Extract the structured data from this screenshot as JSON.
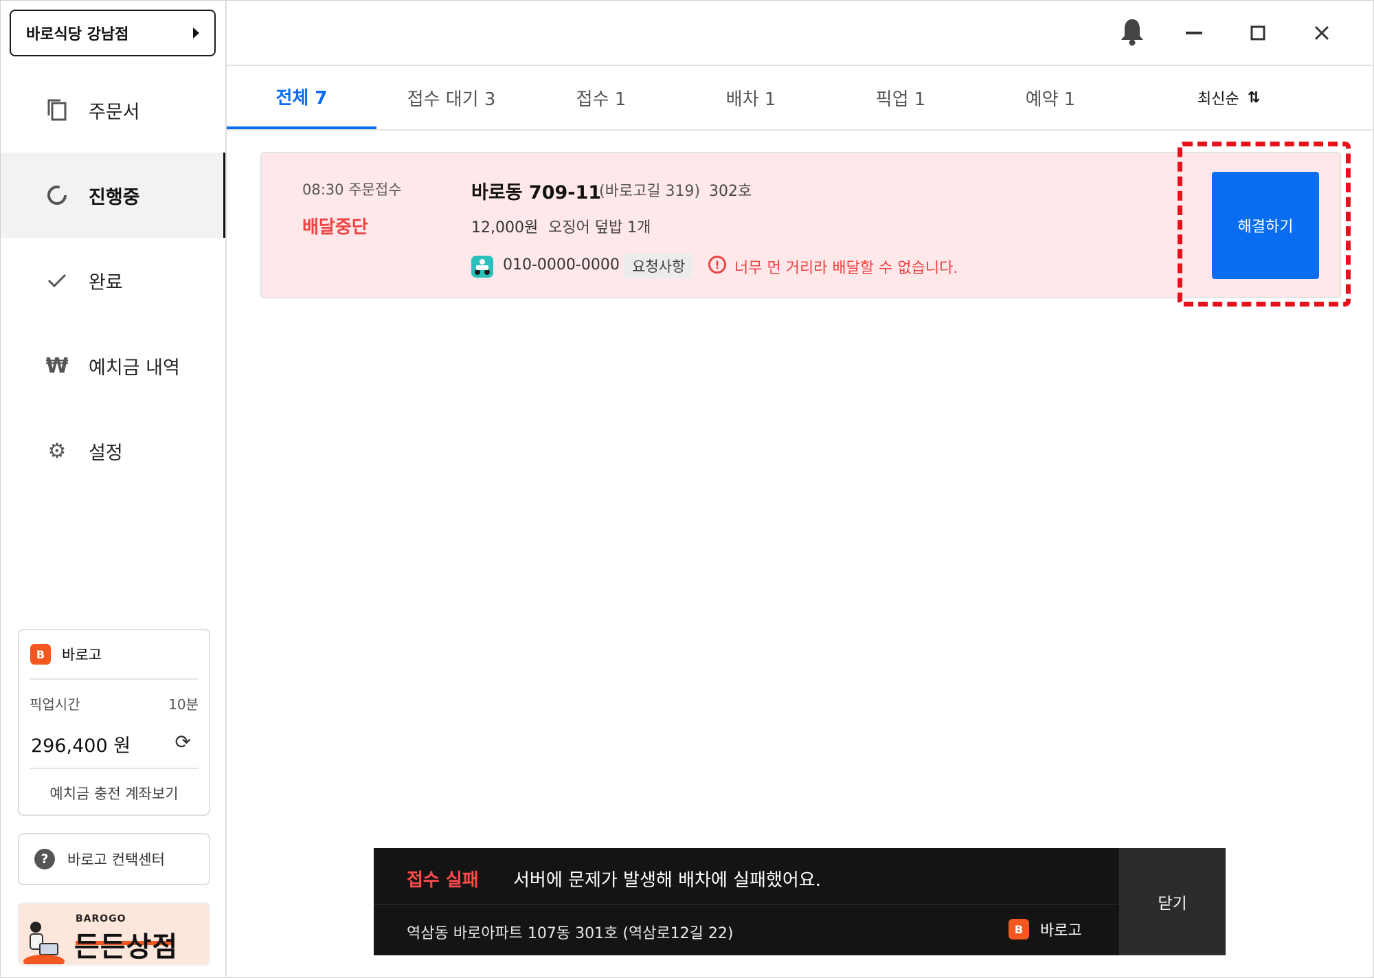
{
  "store": {
    "name": "바로식당 강남점"
  },
  "sidebar": {
    "items": [
      {
        "label": "주문서",
        "icon": "copy-icon"
      },
      {
        "label": "진행중",
        "icon": "progress-icon"
      },
      {
        "label": "완료",
        "icon": "check-icon"
      },
      {
        "label": "예치금 내역",
        "icon": "won-icon"
      },
      {
        "label": "설정",
        "icon": "gear-icon"
      }
    ],
    "active_index": 1,
    "barogo_card": {
      "brand": "바로고",
      "pickup_label": "픽업시간",
      "pickup_value": "10분",
      "amount": "296,400 원",
      "deposit_link": "예치금 충전 계좌보기"
    },
    "contact_center": "바로고 컨택센터",
    "banner": {
      "brand": "BAROGO",
      "title": "든든상점"
    }
  },
  "tabs": [
    {
      "label": "전체 7",
      "active": true
    },
    {
      "label": "접수 대기 3"
    },
    {
      "label": "접수 1"
    },
    {
      "label": "배차 1"
    },
    {
      "label": "픽업 1"
    },
    {
      "label": "예약 1"
    }
  ],
  "sort": {
    "label": "최신순",
    "icon": "sort-icon"
  },
  "order": {
    "time": "08:30 주문접수",
    "status": "배달중단",
    "address_main": "바로동 709-11",
    "address_sub": "(바로고길 319)",
    "address_unit": "302호",
    "price": "12,000원",
    "menu": "오징어 덮밥 1개",
    "phone": "010-0000-0000",
    "request_chip": "요청사항",
    "warning": "너무 먼 거리라 배달할 수 없습니다.",
    "resolve_button": "해결하기"
  },
  "toast": {
    "title": "접수 실패",
    "message": "서버에 문제가 발생해 배차에 실패했어요.",
    "address": "역삼동 바로아파트 107동 301호 (역삼로12길 22)",
    "brand": "바로고",
    "close_label": "닫기"
  },
  "colors": {
    "accent": "#0a6cf0",
    "danger": "#ef4242",
    "highlight": "#e8111b",
    "brand_orange": "#f2581f",
    "order_bg": "#ffe8e9",
    "toast_bg": "#141414"
  }
}
